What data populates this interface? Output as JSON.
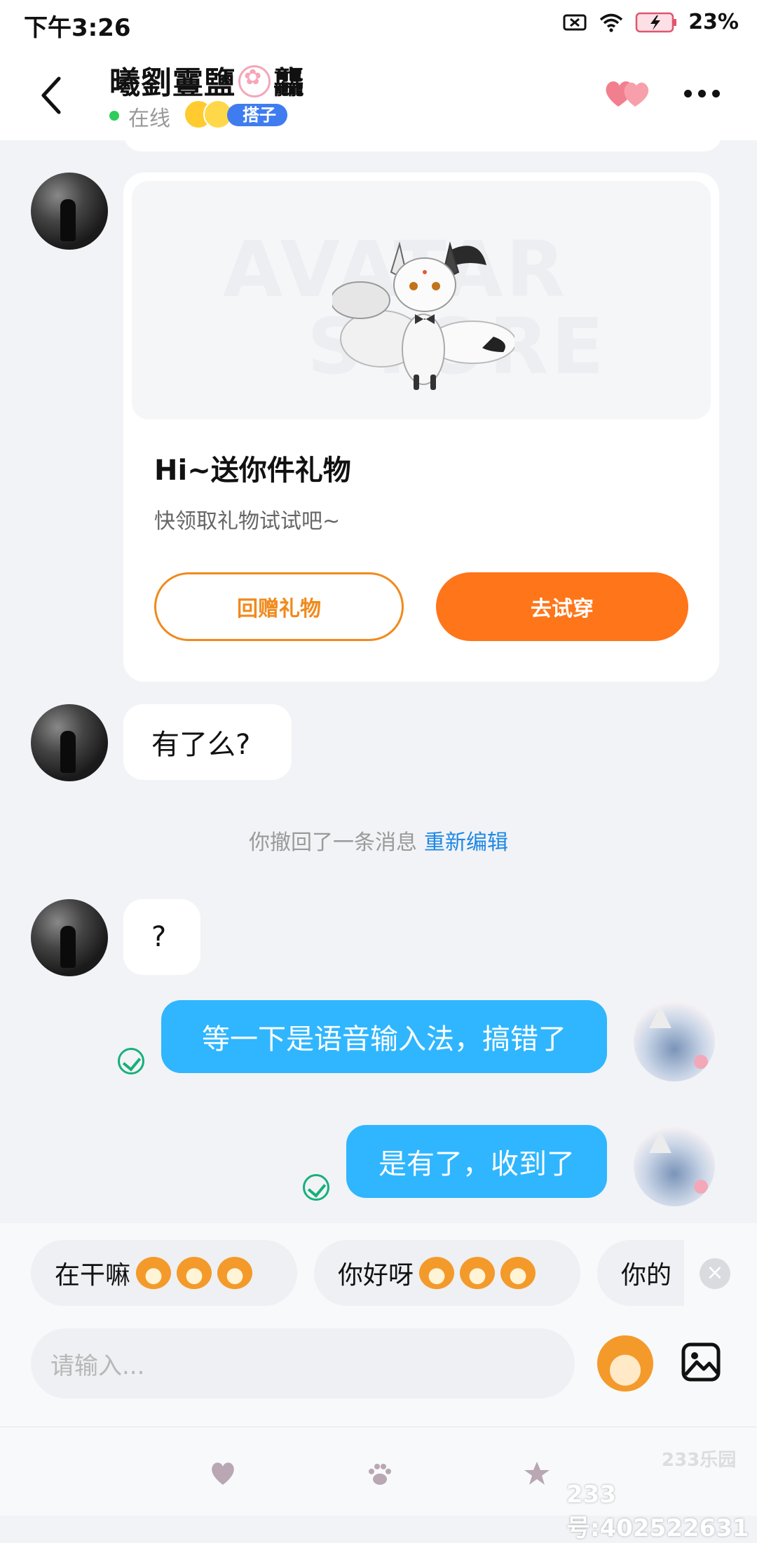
{
  "status_bar": {
    "time": "下午3:26",
    "battery": "23%"
  },
  "header": {
    "contact_name": "曦劉霻鹽",
    "contact_name_tail": "龘",
    "online_status": "在线",
    "relation_tag": "搭子",
    "icons": [
      "back-icon",
      "hearts-icon",
      "more-icon"
    ]
  },
  "messages": {
    "gift_card": {
      "watermark_1": "AVATAR",
      "watermark_2": "STORE",
      "title": "Hi~送你件礼物",
      "subtitle": "快领取礼物试试吧~",
      "return_gift_label": "回赠礼物",
      "try_on_label": "去试穿"
    },
    "msg_have_it": "有了么?",
    "recall_text": "你撤回了一条消息",
    "recall_edit": "重新编辑",
    "msg_question": "?",
    "msg_voice_input": "等一下是语音输入法，搞错了",
    "msg_got_it": "是有了，收到了"
  },
  "quick_replies": [
    "在干嘛",
    "你好呀",
    "你的"
  ],
  "input": {
    "placeholder": "请输入..."
  },
  "footer": {
    "brand": "233乐园",
    "user_id": "233号:402522631"
  },
  "colors": {
    "accent_orange": "#ff7519",
    "outgoing_bubble": "#2fb6ff",
    "online_green": "#2ecc5a",
    "link_blue": "#1e88e5"
  }
}
